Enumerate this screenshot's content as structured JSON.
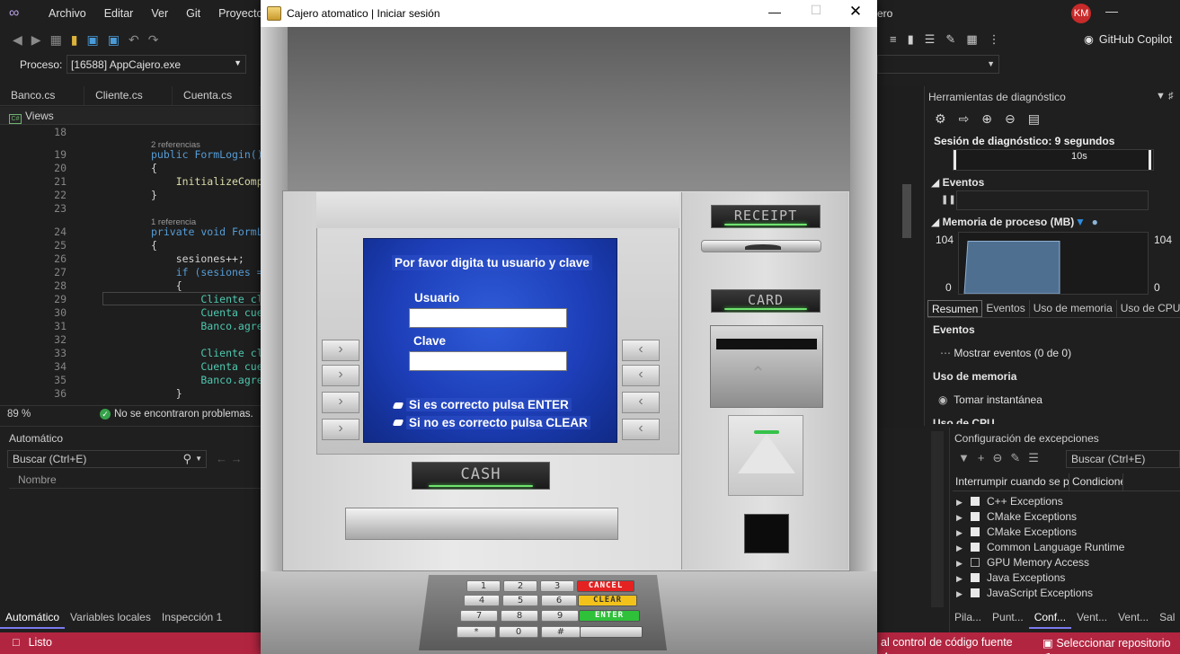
{
  "vs": {
    "menu": [
      "Archivo",
      "Editar",
      "Ver",
      "Git",
      "Proyecto"
    ],
    "title_tail": "ero",
    "avatar": "KM",
    "copilot": "GitHub Copilot",
    "process_label": "Proceso:",
    "process_value": "[16588] AppCajero.exe",
    "doc_tabs": [
      "Banco.cs",
      "Cliente.cs",
      "Cuenta.cs"
    ],
    "views_label": "Views",
    "cs_badge": "C#",
    "code": [
      {
        "ln": "18",
        "text": ""
      },
      {
        "ln": "",
        "text": "2 referencias",
        "hint": true
      },
      {
        "ln": "19",
        "text": "public FormLogin()"
      },
      {
        "ln": "20",
        "text": "{"
      },
      {
        "ln": "21",
        "text": "    InitializeComp"
      },
      {
        "ln": "22",
        "text": "}"
      },
      {
        "ln": "23",
        "text": ""
      },
      {
        "ln": "",
        "text": "1 referencia",
        "hint": true
      },
      {
        "ln": "24",
        "text": "private void FormL"
      },
      {
        "ln": "25",
        "text": "{"
      },
      {
        "ln": "26",
        "text": "    sesiones++;"
      },
      {
        "ln": "27",
        "text": "    if (sesiones ="
      },
      {
        "ln": "28",
        "text": "    {"
      },
      {
        "ln": "29",
        "text": "        Cliente cl"
      },
      {
        "ln": "30",
        "text": "        Cuenta cue"
      },
      {
        "ln": "31",
        "text": "        Banco.agre"
      },
      {
        "ln": "32",
        "text": ""
      },
      {
        "ln": "33",
        "text": "        Cliente cl"
      },
      {
        "ln": "34",
        "text": "        Cuenta cue"
      },
      {
        "ln": "35",
        "text": "        Banco.agre"
      },
      {
        "ln": "36",
        "text": "    }"
      }
    ],
    "zoom": "89 %",
    "no_problems": "No se encontraron problemas.",
    "auto_title": "Automático",
    "auto_search": "Buscar (Ctrl+E)",
    "col_name": "Nombre",
    "auto_tabs": [
      "Automático",
      "Variables locales",
      "Inspección 1"
    ],
    "status_ready": "Listo",
    "status_source": "al control de código fuente",
    "status_repo": "Seleccionar repositorio",
    "diag": {
      "title": "Herramientas de diagnóstico",
      "session": "Sesión de diagnóstico: 9 segundos",
      "tick": "10s",
      "events_title": "Eventos",
      "memory_title": "Memoria de proceso (MB)",
      "mem_max": "104",
      "mem_min": "0",
      "mem_level": 0.86,
      "tabs": [
        "Resumen",
        "Eventos",
        "Uso de memoria",
        "Uso de CPU"
      ],
      "sec_events": "Eventos",
      "show_events": "Mostrar eventos (0 de 0)",
      "sec_memory": "Uso de memoria",
      "snapshot": "Tomar instantánea",
      "sec_cpu": "Uso de CPU"
    },
    "exc": {
      "title": "Configuración de excepciones",
      "search": "Buscar (Ctrl+E)",
      "col_break": "Interrumpir cuando se produzca",
      "col_cond": "Condiciones",
      "rows": [
        {
          "label": "C++ Exceptions",
          "checked": true
        },
        {
          "label": "CMake Exceptions",
          "checked": true
        },
        {
          "label": "CMake Exceptions",
          "checked": true
        },
        {
          "label": "Common Language Runtime",
          "checked": true
        },
        {
          "label": "GPU Memory Access",
          "checked": false
        },
        {
          "label": "Java Exceptions",
          "checked": true
        },
        {
          "label": "JavaScript Exceptions",
          "checked": true
        }
      ],
      "tabs": [
        "Pila...",
        "Punt...",
        "Conf...",
        "Vent...",
        "Vent...",
        "Sal"
      ]
    }
  },
  "atm": {
    "window_title": "Cajero atomatico | Iniciar sesión",
    "prompt": "Por favor digita tu usuario y clave",
    "user_label": "Usuario",
    "user_value": "",
    "pass_label": "Clave",
    "pass_value": "",
    "hint_enter": "Si es correcto pulsa ENTER",
    "hint_clear": "Si no es correcto pulsa CLEAR",
    "receipt": "RECEIPT",
    "card": "CARD",
    "cash": "CASH",
    "keys": [
      "1",
      "2",
      "3",
      "4",
      "5",
      "6",
      "7",
      "8",
      "9",
      "*",
      "0",
      "#"
    ],
    "cancel": "CANCEL",
    "clear": "CLEAR",
    "enter": "ENTER",
    "colors": {
      "cancel": "#e52222",
      "clear": "#f2c21a",
      "enter": "#2fc13a",
      "screen": "#1d3eb8"
    }
  }
}
